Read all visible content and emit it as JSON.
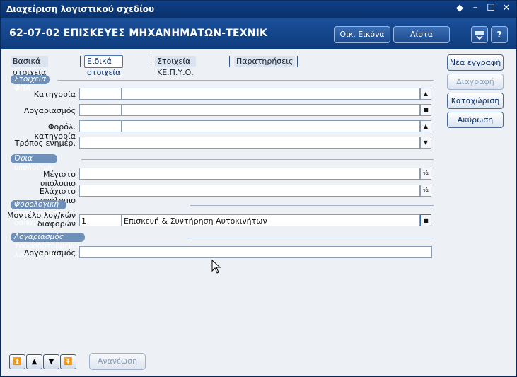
{
  "window": {
    "title": "Διαχείριση λογιστικού σχεδίου"
  },
  "header": {
    "record_title": "62-07-02 ΕΠΙΣΚΕΥΕΣ ΜΗΧΑΝΗΜΑΤΩΝ-ΤΕΧΝΙΚ",
    "btn_oik": "Οικ. Εικόνα",
    "btn_list": "Λίστα",
    "icon_menu": "menu-icon",
    "icon_help": "?"
  },
  "tabs": [
    {
      "label": "Βασικά στοιχεία",
      "active": false
    },
    {
      "label": "Ειδικά στοιχεία",
      "active": true
    },
    {
      "label": "Στοιχεία ΚΕ.Π.Υ.Ο.",
      "active": false
    },
    {
      "label": "Παρατηρήσεις",
      "active": false
    }
  ],
  "sections": {
    "fpa": "Στοιχεία ΦΠΑ",
    "limits": "Όρια υπολοίπων",
    "tax": "Φορολογική αναμόρφωση δαπανών",
    "fed": "Λογαριασμός τροφοδοτούμενου λογ. σχεδίου"
  },
  "fields": {
    "category": {
      "label": "Κατηγορία",
      "code": "",
      "value": ""
    },
    "account": {
      "label": "Λογαριασμός",
      "code": "",
      "value": ""
    },
    "tax_category": {
      "label": "Φορόλ. κατηγορία",
      "code": "",
      "value": ""
    },
    "update_method": {
      "label": "Τρόπος ενημέρ.",
      "value": ""
    },
    "max_balance": {
      "label": "Μέγιστο υπόλοιπο",
      "value": ""
    },
    "min_balance": {
      "label": "Ελάχιστο υπόλοιπο",
      "value": ""
    },
    "diff_model": {
      "label_line1": "Μοντέλο λογ/κών",
      "label_line2": "διαφορών",
      "code": "1",
      "value": "Επισκευή & Συντήρηση Αυτοκινήτων"
    },
    "fed_account": {
      "label": "Λογαριασμός",
      "value": ""
    }
  },
  "actions": {
    "new": "Νέα εγγραφή",
    "delete": "Διαγραφή",
    "save": "Καταχώριση",
    "cancel": "Ακύρωση"
  },
  "footer": {
    "refresh": "Ανανέωση"
  },
  "colors": {
    "title_bar": "#0e3f87",
    "header": "#1a4f9a",
    "section_badge": "#6d8fb8",
    "background": "#edf0f5"
  }
}
